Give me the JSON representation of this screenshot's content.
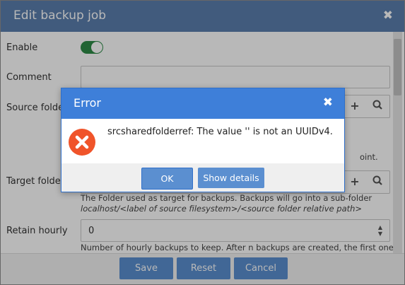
{
  "dialog": {
    "title": "Edit backup job",
    "close_symbol": "✖",
    "fields": {
      "enable_label": "Enable",
      "enable_value": true,
      "comment_label": "Comment",
      "comment_value": "",
      "source_label": "Source folder",
      "source_hint_suffix": "oint.",
      "target_label": "Target folder",
      "target_hint": "The Folder used as target for backups. Backups will go into a sub-folder",
      "target_hint_path": "localhost/<label of source filesystem>/<source folder relative path>",
      "retain_label": "Retain hourly",
      "retain_value": "0",
      "retain_hint": "Number of hourly backups to keep. After n backups are created, the first one will be"
    },
    "buttons": {
      "save": "Save",
      "reset": "Reset",
      "cancel": "Cancel"
    }
  },
  "error_modal": {
    "title": "Error",
    "close_symbol": "✖",
    "message": "srcsharedfolderref: The value '' is not an UUIDv4.",
    "ok_label": "OK",
    "details_label": "Show details",
    "icon": "error-icon"
  },
  "icons": {
    "add": "+",
    "search": "search-icon"
  },
  "colors": {
    "title_bar": "#5a7fae",
    "modal_title_bar": "#3e7fd9",
    "button": "#5b8fd0",
    "toggle_on": "#2e8b47",
    "error_icon": "#f0542a"
  }
}
